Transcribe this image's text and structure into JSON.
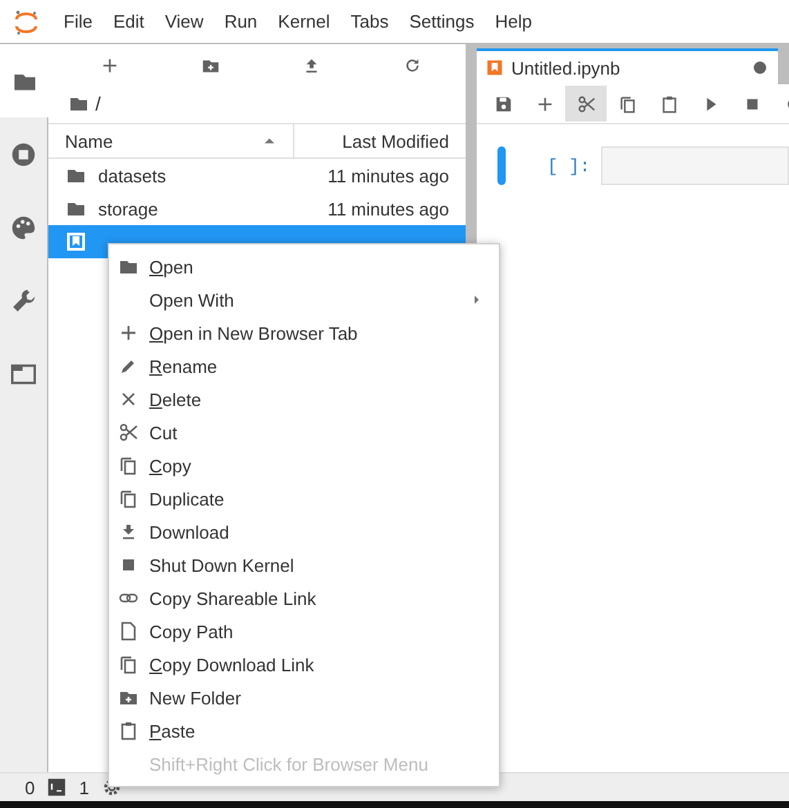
{
  "menu_bar": [
    "File",
    "Edit",
    "View",
    "Run",
    "Kernel",
    "Tabs",
    "Settings",
    "Help"
  ],
  "sidebar": {
    "tabs": [
      {
        "selected": true
      },
      {
        "selected": false
      },
      {
        "selected": false
      },
      {
        "selected": false
      },
      {
        "selected": false
      }
    ]
  },
  "file_browser": {
    "breadcrumb": "/",
    "columns": [
      {
        "label": "Name",
        "sorted": true
      },
      {
        "label": "Last Modified",
        "sorted": false
      }
    ],
    "rows": [
      {
        "name": "datasets",
        "modified": "11 minutes ago",
        "selected": false,
        "kind": "folder"
      },
      {
        "name": "storage",
        "modified": "11 minutes ago",
        "selected": false,
        "kind": "folder"
      },
      {
        "selected": true,
        "kind": "notebook"
      }
    ]
  },
  "notebook": {
    "tab": {
      "title": "Untitled.ipynb"
    },
    "toolbar": [
      {
        "pressed": false
      },
      {
        "pressed": false
      },
      {
        "pressed": true
      },
      {
        "pressed": false
      },
      {
        "pressed": false
      },
      {
        "pressed": false
      },
      {
        "pressed": false
      },
      {
        "pressed": false
      }
    ],
    "cell": {
      "prompt": "[ ]:"
    }
  },
  "context_menu": [
    {
      "label": "Open",
      "mnemonic": true,
      "kind": "item"
    },
    {
      "label": "Open With",
      "mnemonic": false,
      "kind": "submenu"
    },
    {
      "label": "Open in New Browser Tab",
      "mnemonic": true,
      "kind": "item"
    },
    {
      "label": "Rename",
      "mnemonic": true,
      "kind": "item"
    },
    {
      "label": "Delete",
      "mnemonic": true,
      "kind": "item"
    },
    {
      "label": "Cut",
      "mnemonic": false,
      "kind": "item"
    },
    {
      "label": "Copy",
      "mnemonic": true,
      "kind": "item"
    },
    {
      "label": "Duplicate",
      "mnemonic": false,
      "kind": "item"
    },
    {
      "label": "Download",
      "mnemonic": false,
      "kind": "item"
    },
    {
      "label": "Shut Down Kernel",
      "mnemonic": false,
      "kind": "item"
    },
    {
      "label": "Copy Shareable Link",
      "mnemonic": false,
      "kind": "item"
    },
    {
      "label": "Copy Path",
      "mnemonic": false,
      "kind": "item"
    },
    {
      "label": "Copy Download Link",
      "mnemonic": true,
      "kind": "item"
    },
    {
      "label": "New Folder",
      "mnemonic": false,
      "kind": "item"
    },
    {
      "label": "Paste",
      "mnemonic": true,
      "kind": "item"
    },
    {
      "label": "Shift+Right Click for Browser Menu",
      "mnemonic": false,
      "kind": "hint"
    }
  ],
  "status_bar": {
    "terminals": "0",
    "kernels": "1"
  }
}
